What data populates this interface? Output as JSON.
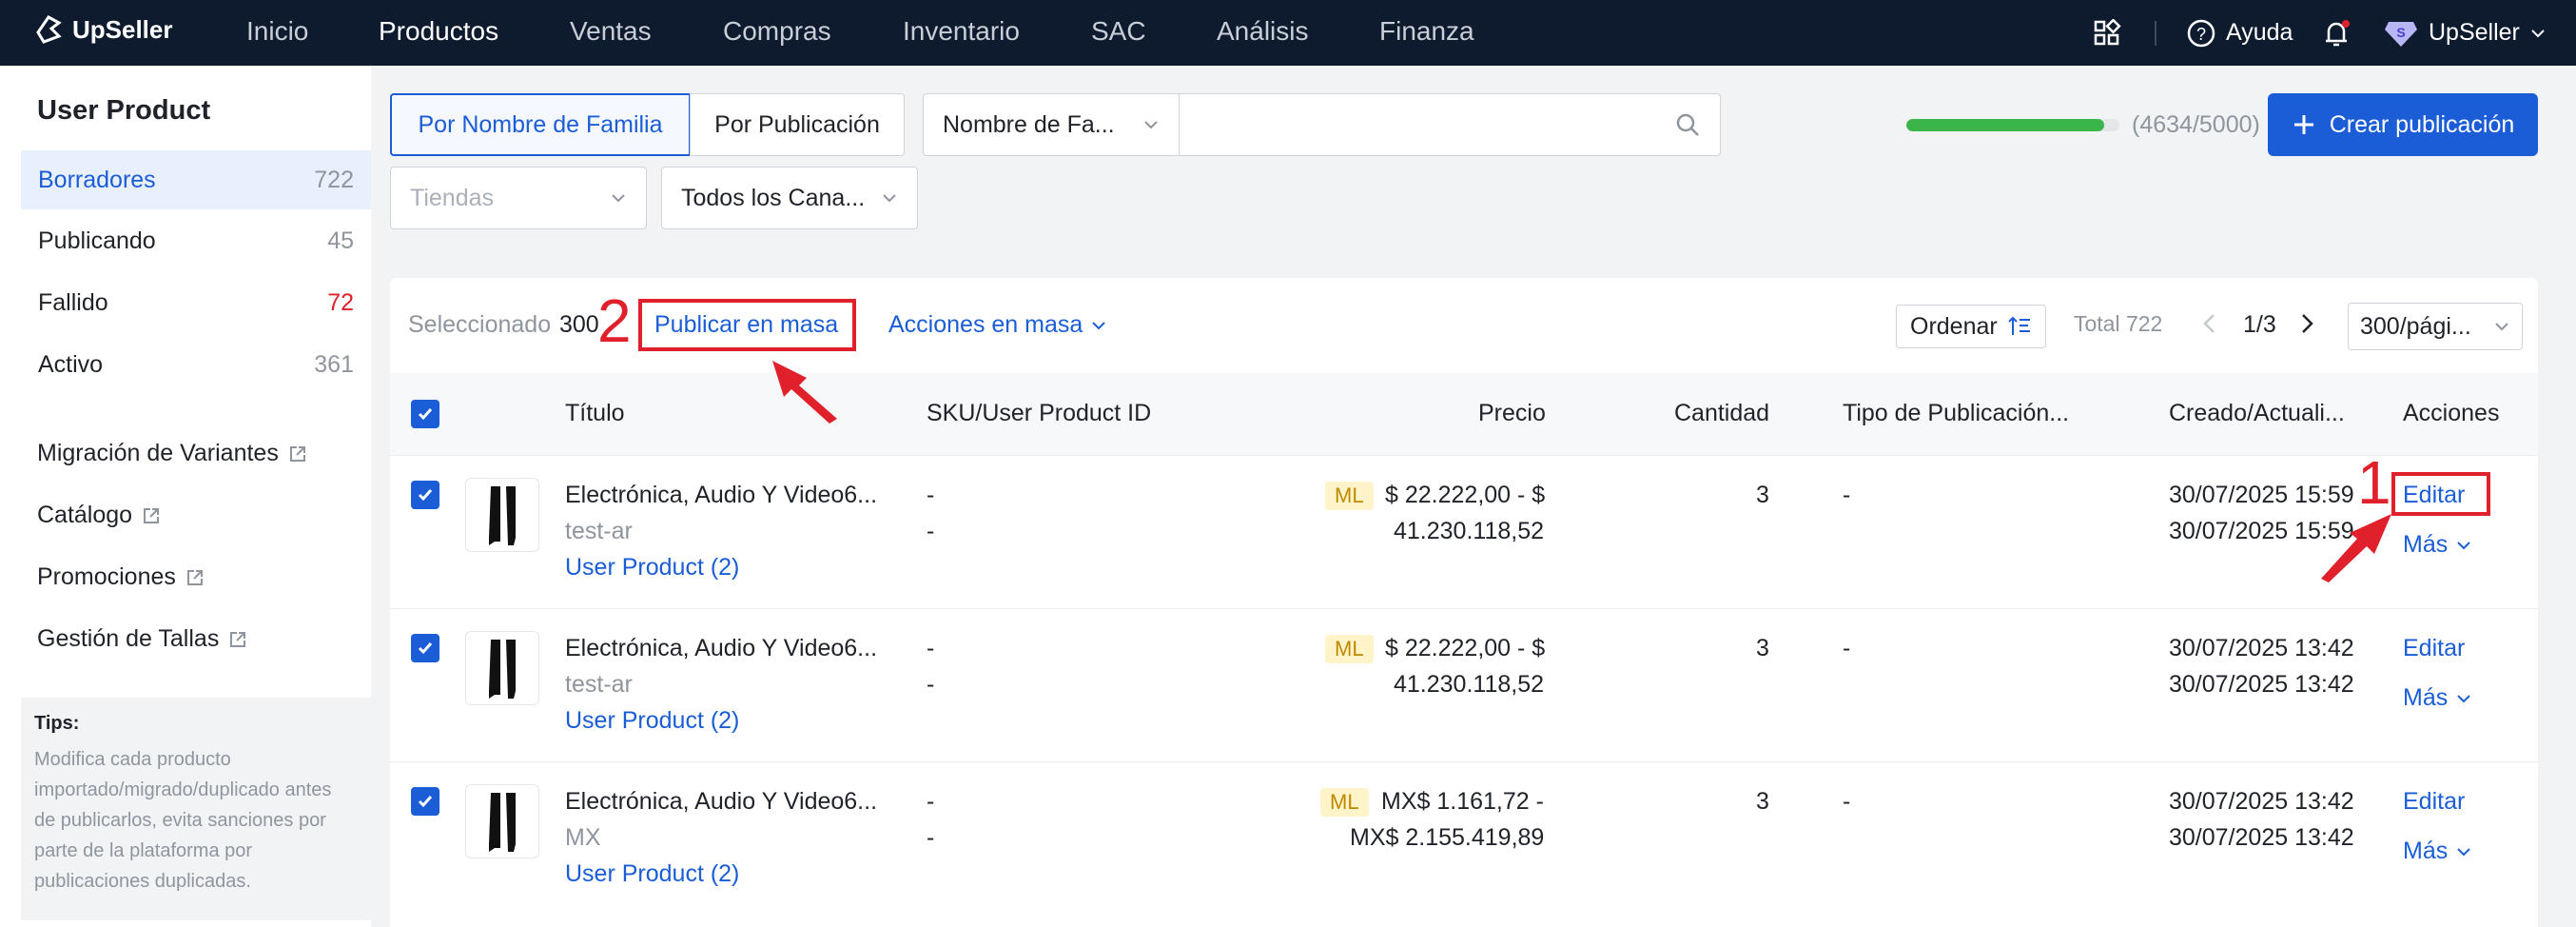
{
  "nav": {
    "logo": "UpSeller",
    "items": [
      "Inicio",
      "Productos",
      "Ventas",
      "Compras",
      "Inventario",
      "SAC",
      "Análisis",
      "Finanza"
    ],
    "help": "Ayuda",
    "user": "UpSeller"
  },
  "sidebar": {
    "title": "User Product",
    "items": [
      {
        "label": "Borradores",
        "count": "722"
      },
      {
        "label": "Publicando",
        "count": "45"
      },
      {
        "label": "Fallido",
        "count": "72"
      },
      {
        "label": "Activo",
        "count": "361"
      }
    ],
    "links": [
      "Migración de Variantes",
      "Catálogo",
      "Promociones",
      "Gestión de Tallas"
    ],
    "tips_title": "Tips:",
    "tips_lines": [
      "Modifica cada producto",
      "importado/migrado/duplicado antes",
      "de publicarlos, evita sanciones por",
      "parte de la plataforma por",
      "publicaciones duplicadas."
    ]
  },
  "filters": {
    "tab_family": "Por Nombre de Familia",
    "tab_publication": "Por Publicación",
    "search_field": "Nombre de Fa...",
    "quota_text": "(4634/5000)",
    "quota_percent": 92.68,
    "create_button": "Crear publicación",
    "stores_placeholder": "Tiendas",
    "channels": "Todos los Cana..."
  },
  "toolbar": {
    "selected_label": "Seleccionado",
    "selected_count": "300",
    "bulk_publish": "Publicar en masa",
    "bulk_actions": "Acciones en masa",
    "sort": "Ordenar",
    "total": "Total 722",
    "page": "1/3",
    "per_page": "300/pági..."
  },
  "table": {
    "headers": [
      "Título",
      "SKU/User Product ID",
      "Precio",
      "Cantidad",
      "Tipo de Publicación...",
      "Creado/Actuali...",
      "Acciones"
    ],
    "rows": [
      {
        "title": "Electrónica, Audio Y Video6...",
        "sub": "test-ar",
        "up": "User Product (2)",
        "sku1": "-",
        "sku2": "-",
        "badge": "ML",
        "price1": "$ 22.222,00 - $",
        "price2": "41.230.118,52",
        "qty": "3",
        "type": "-",
        "created": "30/07/2025 15:59",
        "updated": "30/07/2025 15:59",
        "edit": "Editar",
        "more": "Más"
      },
      {
        "title": "Electrónica, Audio Y Video6...",
        "sub": "test-ar",
        "up": "User Product (2)",
        "sku1": "-",
        "sku2": "-",
        "badge": "ML",
        "price1": "$ 22.222,00 - $",
        "price2": "41.230.118,52",
        "qty": "3",
        "type": "-",
        "created": "30/07/2025 13:42",
        "updated": "30/07/2025 13:42",
        "edit": "Editar",
        "more": "Más"
      },
      {
        "title": "Electrónica, Audio Y Video6...",
        "sub": "MX",
        "up": "User Product (2)",
        "sku1": "-",
        "sku2": "-",
        "badge": "ML",
        "price1": "MX$ 1.161,72 -",
        "price2": "MX$ 2.155.419,89",
        "qty": "3",
        "type": "-",
        "created": "30/07/2025 13:42",
        "updated": "30/07/2025 13:42",
        "edit": "Editar",
        "more": "Más"
      }
    ]
  },
  "annotations": {
    "one": "1",
    "two": "2"
  },
  "colors": {
    "nav_bg": "#0e1b2e",
    "accent": "#1a5dd6",
    "annotation": "#e0202a",
    "progress": "#3ab54a"
  }
}
